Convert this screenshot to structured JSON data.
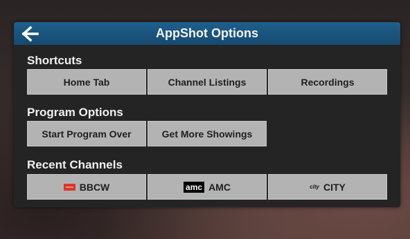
{
  "header": {
    "title": "AppShot Options",
    "back_icon": "arrow-left-icon"
  },
  "sections": {
    "shortcuts": {
      "label": "Shortcuts",
      "buttons": [
        "Home Tab",
        "Channel Listings",
        "Recordings"
      ]
    },
    "program_options": {
      "label": "Program Options",
      "buttons": [
        "Start Program Over",
        "Get More Showings"
      ]
    },
    "recent_channels": {
      "label": "Recent Channels",
      "channels": [
        {
          "logo": "bbc-logo",
          "label": "BBCW"
        },
        {
          "logo": "amc-logo",
          "logo_text": "amc",
          "label": "AMC"
        },
        {
          "logo": "city-logo",
          "logo_text": "city",
          "label": "CITY"
        }
      ]
    }
  },
  "colors": {
    "titlebar": "#1a527c",
    "panel": "#242424",
    "button": "#b3b3b3",
    "bbc_logo": "#d9362c"
  }
}
